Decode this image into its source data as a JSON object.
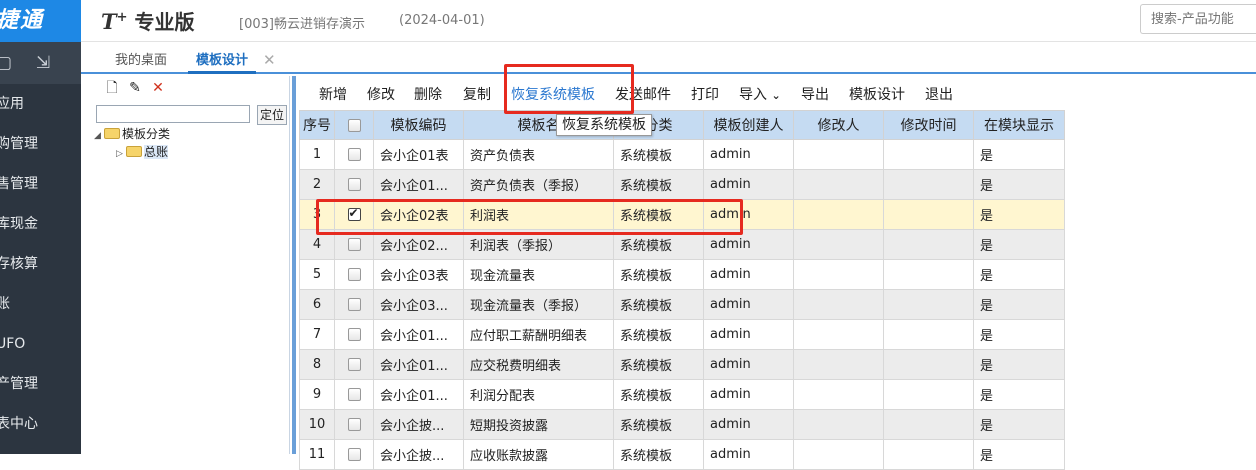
{
  "brand": {
    "text": "捷通"
  },
  "header": {
    "logo_mark": "T",
    "logo_plus": "+",
    "logo_text": "专业版",
    "company": "[003]畅云进销存演示",
    "date": "(2024-04-01)",
    "search_placeholder": "搜索-产品功能"
  },
  "sidebar": {
    "icons": [
      "box-icon",
      "export-icon"
    ],
    "items": [
      {
        "label": "应用"
      },
      {
        "label": "购管理"
      },
      {
        "label": "售管理"
      },
      {
        "label": "库现金"
      },
      {
        "label": "存核算"
      },
      {
        "label": "账"
      },
      {
        "label": "UFO"
      },
      {
        "label": "产管理"
      },
      {
        "label": "表中心"
      }
    ]
  },
  "tabs": {
    "home": "我的桌面",
    "active": "模板设计",
    "close": "✕"
  },
  "tree": {
    "tools": [
      "new-icon",
      "edit-icon",
      "delete-icon"
    ],
    "search_value": "",
    "locate_label": "定位",
    "root": {
      "arrow": "◢",
      "label": "模板分类"
    },
    "child": {
      "arrow": "▷",
      "label": "总账"
    }
  },
  "toolbar": {
    "add": "新增",
    "edit": "修改",
    "delete": "删除",
    "copy": "复制",
    "restore": "恢复系统模板",
    "send_mail": "发送邮件",
    "print": "打印",
    "import": "导入",
    "export": "导出",
    "template_design": "模板设计",
    "exit": "退出"
  },
  "tooltip": "恢复系统模板",
  "table": {
    "columns": [
      "序号",
      "",
      "模板编码",
      "模板名称",
      "模板分类",
      "模板创建人",
      "修改人",
      "修改时间",
      "在模块显示"
    ],
    "header_code": "模板编码",
    "header_name": "模板名",
    "header_category": "分类",
    "rows": [
      {
        "no": "1",
        "checked": false,
        "code": "会小企01表",
        "name": "资产负债表",
        "category": "系统模板",
        "creator": "admin",
        "modifier": "",
        "mtime": "",
        "show": "是"
      },
      {
        "no": "2",
        "checked": false,
        "code": "会小企01...",
        "name": "资产负债表（季报）",
        "category": "系统模板",
        "creator": "admin",
        "modifier": "",
        "mtime": "",
        "show": "是"
      },
      {
        "no": "3",
        "checked": true,
        "code": "会小企02表",
        "name": "利润表",
        "category": "系统模板",
        "creator": "admin",
        "modifier": "",
        "mtime": "",
        "show": "是"
      },
      {
        "no": "4",
        "checked": false,
        "code": "会小企02...",
        "name": "利润表（季报）",
        "category": "系统模板",
        "creator": "admin",
        "modifier": "",
        "mtime": "",
        "show": "是"
      },
      {
        "no": "5",
        "checked": false,
        "code": "会小企03表",
        "name": "现金流量表",
        "category": "系统模板",
        "creator": "admin",
        "modifier": "",
        "mtime": "",
        "show": "是"
      },
      {
        "no": "6",
        "checked": false,
        "code": "会小企03...",
        "name": "现金流量表（季报）",
        "category": "系统模板",
        "creator": "admin",
        "modifier": "",
        "mtime": "",
        "show": "是"
      },
      {
        "no": "7",
        "checked": false,
        "code": "会小企01...",
        "name": "应付职工薪酬明细表",
        "category": "系统模板",
        "creator": "admin",
        "modifier": "",
        "mtime": "",
        "show": "是"
      },
      {
        "no": "8",
        "checked": false,
        "code": "会小企01...",
        "name": "应交税费明细表",
        "category": "系统模板",
        "creator": "admin",
        "modifier": "",
        "mtime": "",
        "show": "是"
      },
      {
        "no": "9",
        "checked": false,
        "code": "会小企01...",
        "name": "利润分配表",
        "category": "系统模板",
        "creator": "admin",
        "modifier": "",
        "mtime": "",
        "show": "是"
      },
      {
        "no": "10",
        "checked": false,
        "code": "会小企披...",
        "name": "短期投资披露",
        "category": "系统模板",
        "creator": "admin",
        "modifier": "",
        "mtime": "",
        "show": "是"
      },
      {
        "no": "11",
        "checked": false,
        "code": "会小企披...",
        "name": "应收账款披露",
        "category": "系统模板",
        "creator": "admin",
        "modifier": "",
        "mtime": "",
        "show": "是"
      }
    ]
  },
  "colors": {
    "brand": "#1e88e5",
    "sidebar": "#2c3540",
    "header_row": "#c5dbf2",
    "selected_row": "#fff6d0",
    "highlight_box": "#e62a1f",
    "accent": "#2b78d0"
  }
}
